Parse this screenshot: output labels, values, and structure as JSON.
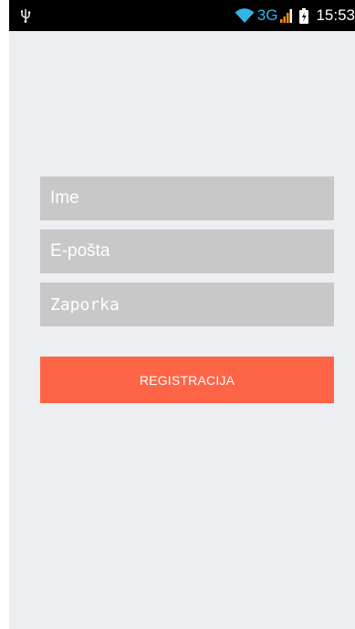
{
  "status_bar": {
    "network_type": "3G",
    "time": "15:53",
    "icons": [
      "usb-icon",
      "wifi-icon",
      "signal-icon",
      "battery-icon"
    ],
    "accent_color": "#33b5e5"
  },
  "form": {
    "name_placeholder": "Ime",
    "email_placeholder": "E-pošta",
    "password_placeholder": "Zaporka",
    "submit_label": "REGISTRACIJA"
  },
  "colors": {
    "background": "#eceef2",
    "field_background": "#c8c8c8",
    "button_background": "#fe6547",
    "text": "#ffffff"
  }
}
